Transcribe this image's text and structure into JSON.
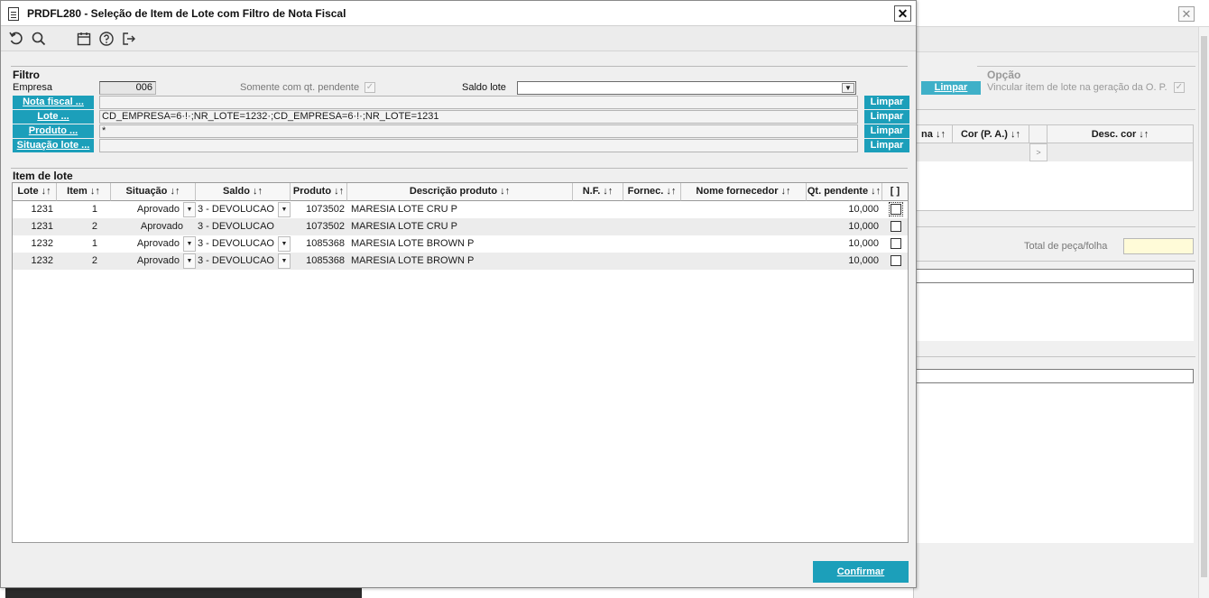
{
  "background_window": {
    "limpar_label": "Limpar",
    "opcao_title": "Opção",
    "opcao_text": "Vincular item de lote na geração da O. P.",
    "grid_headers": [
      "na ↓↑",
      "Cor (P. A.) ↓↑",
      "",
      "Desc. cor ↓↑"
    ],
    "grid_button": ">",
    "total_label": "Total de peça/folha",
    "close_symbol": "✕"
  },
  "dialog": {
    "title": "PRDFL280 - Seleção de Item de Lote com Filtro de Nota Fiscal",
    "close_symbol": "✕",
    "toolbar_icons": [
      "undo-icon",
      "search-icon",
      "calendar-icon",
      "help-icon",
      "exit-icon"
    ]
  },
  "filtro": {
    "title": "Filtro",
    "empresa_label": "Empresa",
    "empresa_value": "006",
    "somente_label": "Somente com qt. pendente",
    "somente_checked": true,
    "saldo_lote_label": "Saldo lote",
    "saldo_lote_value": "",
    "rows": [
      {
        "button": "Nota fiscal ...",
        "value": "",
        "limpar": "Limpar"
      },
      {
        "button": "Lote ...",
        "value": "CD_EMPRESA=6·!·;NR_LOTE=1232·;CD_EMPRESA=6·!·;NR_LOTE=1231",
        "limpar": "Limpar"
      },
      {
        "button": "Produto ...",
        "value": "*",
        "limpar": "Limpar"
      },
      {
        "button": "Situação lote ...",
        "value": "",
        "limpar": "Limpar"
      }
    ]
  },
  "item_de_lote": {
    "title": "Item de lote",
    "headers": [
      "Lote ↓↑",
      "Item ↓↑",
      "Situação ↓↑",
      "Saldo ↓↑",
      "Produto ↓↑",
      "Descrição produto ↓↑",
      "N.F. ↓↑",
      "Fornec. ↓↑",
      "Nome fornecedor ↓↑",
      "Qt. pendente ↓↑",
      "[ ]"
    ],
    "rows": [
      {
        "lote": "1231",
        "item": "1",
        "situacao": "Aprovado",
        "saldo": "3 - DEVOLUCAO",
        "produto": "1073502",
        "descricao": "MARESIA LOTE CRU P",
        "nf": "",
        "fornec": "",
        "nome_fornecedor": "",
        "qt_pendente": "10,000",
        "checked": false
      },
      {
        "lote": "1231",
        "item": "2",
        "situacao": "Aprovado",
        "saldo": "3 - DEVOLUCAO",
        "produto": "1073502",
        "descricao": "MARESIA LOTE CRU P",
        "nf": "",
        "fornec": "",
        "nome_fornecedor": "",
        "qt_pendente": "10,000",
        "checked": false
      },
      {
        "lote": "1232",
        "item": "1",
        "situacao": "Aprovado",
        "saldo": "3 - DEVOLUCAO",
        "produto": "1085368",
        "descricao": "MARESIA LOTE BROWN P",
        "nf": "",
        "fornec": "",
        "nome_fornecedor": "",
        "qt_pendente": "10,000",
        "checked": false
      },
      {
        "lote": "1232",
        "item": "2",
        "situacao": "Aprovado",
        "saldo": "3 - DEVOLUCAO",
        "produto": "1085368",
        "descricao": "MARESIA LOTE BROWN P",
        "nf": "",
        "fornec": "",
        "nome_fornecedor": "",
        "qt_pendente": "10,000",
        "checked": false
      }
    ]
  },
  "confirmar_label": "Confirmar",
  "colors": {
    "accent": "#1c9fba",
    "panel": "#efefef",
    "row_alt": "#ececec"
  }
}
